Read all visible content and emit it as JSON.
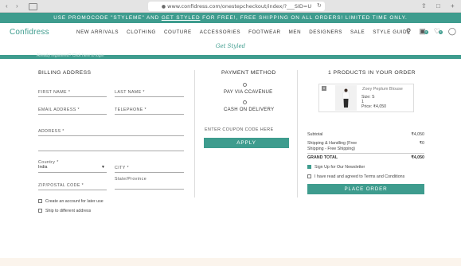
{
  "browser": {
    "url": "www.confidress.com/onestepcheckout/index/?___SID=U"
  },
  "promo": {
    "text_before": "USE PROMOCODE \"STYLEME\" AND ",
    "link": "GET STYLED",
    "text_after": " FOR FREE!, FREE SHIPPING ON ALL ORDERS! LIMITED TIME ONLY."
  },
  "header": {
    "logo": "Confidress",
    "tagline": "Get Styled",
    "nav": [
      "NEW ARRIVALS",
      "CLOTHING",
      "COUTURE",
      "ACCESSORIES",
      "FOOTWEAR",
      "MEN",
      "DESIGNERS",
      "SALE",
      "STYLE GUIDE"
    ],
    "cart_count": "0",
    "wishlist_count": "0"
  },
  "strip_text": "Already registered? Click here to login",
  "billing": {
    "title": "BILLING ADDRESS",
    "first_name": "FIRST NAME *",
    "last_name": "LAST NAME *",
    "email": "EMAIL ADDRESS *",
    "telephone": "TELEPHONE *",
    "address": "ADDRESS *",
    "country_label": "Country *",
    "country_value": "India",
    "city": "CITY *",
    "state": "State/Province",
    "zip": "ZIP/POSTAL CODE *",
    "create_account": "Create an account for later use",
    "ship_different": "Ship to different address"
  },
  "payment": {
    "title": "PAYMENT METHOD",
    "option1": "PAY VIA CCAVENUE",
    "option2": "CASH ON DELIVERY",
    "coupon_label": "ENTER COUPON CODE HERE",
    "apply": "APPLY"
  },
  "order": {
    "title": "1 PRODUCTS IN YOUR ORDER",
    "remove": "x",
    "product_name": "Zoey Peplum Blouse",
    "size": "Size: S",
    "qty": "1",
    "price": "Price: ₹4,050",
    "subtotal_label": "Subtotal",
    "subtotal_value": "₹4,050",
    "shipping_label": "Shipping & Handling (Free Shipping - Free Shipping)",
    "shipping_value": "₹0",
    "grand_label": "GRAND TOTAL",
    "grand_value": "₹4,050",
    "newsletter": "Sign Up for Our Newsletter",
    "terms": "I have read and agreed to Terms and Conditions",
    "place_order": "PLACE ORDER"
  },
  "colors": {
    "brand": "#3e9c8e"
  }
}
